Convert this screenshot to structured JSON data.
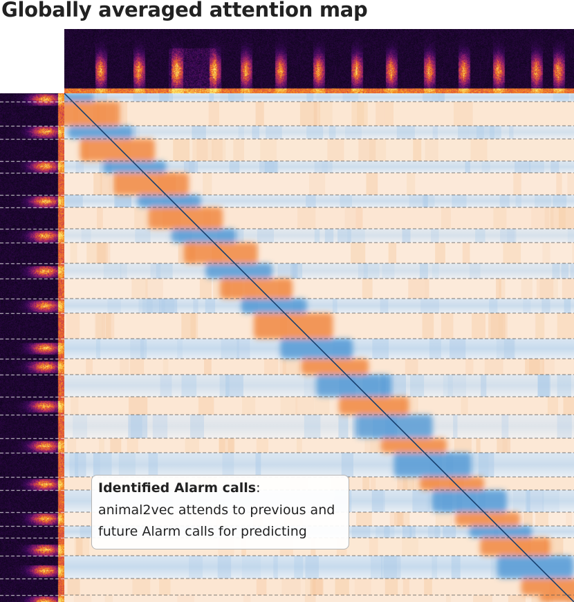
{
  "title": "Globally averaged attention map",
  "callout": {
    "heading": "Identified Alarm calls",
    "heading_suffix": ":",
    "line1": "animal2vec attends to previous and",
    "line2": "future Alarm calls for predicting"
  },
  "colors": {
    "title_text": "#222222",
    "positive_orange": "#e8722a",
    "negative_blue": "#2f7ec0",
    "diagonal": "#1c4f8a",
    "spectrogram_background": "#05030f",
    "spectrogram_hot": "#f4c83c",
    "separator_dashes": "#ffffff",
    "callout_border": "#b4b4b4"
  }
}
